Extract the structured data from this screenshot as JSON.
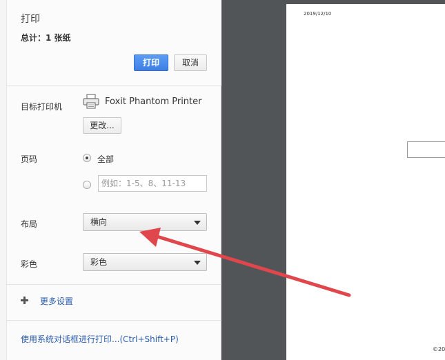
{
  "header": {
    "title": "打印",
    "summary": "总计：1 张纸",
    "print_label": "打印",
    "cancel_label": "取消"
  },
  "destination": {
    "label": "目标打印机",
    "printer_name": "Foxit Phantom Printer",
    "change_label": "更改..."
  },
  "pages": {
    "label": "页码",
    "all_label": "全部",
    "custom_placeholder": "例如：1-5、8、11-13",
    "selected": "all"
  },
  "layout": {
    "label": "布局",
    "value": "横向"
  },
  "color": {
    "label": "彩色",
    "value": "彩色"
  },
  "more_settings": "更多设置",
  "system_dialog_link": "使用系统对话框进行打印...(Ctrl+Shift+P)",
  "preview": {
    "date": "2019/12/10",
    "footer": "©20"
  },
  "colors": {
    "primary_button": "#4a8af0",
    "link": "#2a5db0",
    "preview_background": "#525558",
    "annotation_arrow": "#e0474c"
  },
  "icons": {
    "printer": "printer-icon",
    "more": "plus-icon",
    "dropdown": "chevron-down-icon"
  }
}
